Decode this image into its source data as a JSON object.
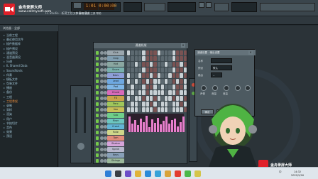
{
  "app": {
    "title_bar": "FL Studio - 新建工程 - 节奏与模式",
    "counter_a": "1:01",
    "counter_b": "0:00:00",
    "menu": [
      "文件",
      "编辑",
      "通道",
      "工具",
      "帮助"
    ]
  },
  "watermark": {
    "name": "金舟录屏大师",
    "url": "www.callmysoft.com"
  },
  "browser": {
    "header": "浏览器 - 全部",
    "items": [
      {
        "label": "当前工程",
        "active": false
      },
      {
        "label": "最近使用文件",
        "active": false
      },
      {
        "label": "插件数据库",
        "active": false
      },
      {
        "label": "插件预设",
        "active": false
      },
      {
        "label": "通道预设",
        "active": false
      },
      {
        "label": "混音器预设",
        "active": false
      },
      {
        "label": "乐谱",
        "active": false
      },
      {
        "label": "IL Shared Data",
        "active": false
      },
      {
        "label": "Soundfonts",
        "active": false
      },
      {
        "label": "伴奏",
        "active": false
      },
      {
        "label": "模板文件",
        "active": false
      },
      {
        "label": "包装文件",
        "active": false
      },
      {
        "label": "播放",
        "active": false
      },
      {
        "label": "备份",
        "active": false
      },
      {
        "label": "工程",
        "active": false
      },
      {
        "label": "工程骨架",
        "active": true
      },
      {
        "label": "录制",
        "active": false
      },
      {
        "label": "采样",
        "active": false
      },
      {
        "label": "渲染",
        "active": false
      },
      {
        "label": "用户",
        "active": false
      },
      {
        "label": "节拍切片",
        "active": false
      },
      {
        "label": "音色",
        "active": false
      },
      {
        "label": "效果",
        "active": false
      },
      {
        "label": "预设",
        "active": false
      }
    ]
  },
  "channel_rack": {
    "title": "通道机架",
    "close": "×",
    "channels": [
      {
        "name": "Kick",
        "color": "#9aa6ad",
        "steps": [
          1,
          0,
          0,
          0,
          1,
          0,
          0,
          0,
          1,
          0,
          0,
          0,
          1,
          0,
          0,
          0
        ]
      },
      {
        "name": "Clap",
        "color": "#7f9db0",
        "steps": [
          0,
          0,
          0,
          0,
          1,
          0,
          0,
          0,
          0,
          0,
          0,
          0,
          1,
          0,
          0,
          0
        ]
      },
      {
        "name": "Hat",
        "color": "#8aa7a1",
        "steps": [
          0,
          0,
          1,
          0,
          0,
          0,
          1,
          0,
          0,
          0,
          1,
          0,
          0,
          0,
          1,
          0
        ]
      },
      {
        "name": "Snare",
        "color": "#79b0ad",
        "steps": [
          0,
          0,
          0,
          0,
          1,
          0,
          0,
          0,
          0,
          0,
          0,
          0,
          1,
          0,
          0,
          1
        ]
      },
      {
        "name": "Bass",
        "color": "#8e9fd8",
        "steps": [
          1,
          0,
          0,
          1,
          0,
          0,
          1,
          0,
          1,
          0,
          0,
          1,
          0,
          0,
          1,
          0
        ]
      },
      {
        "name": "Lead",
        "color": "#6ea8e0",
        "steps": [
          1,
          0,
          1,
          0,
          0,
          1,
          0,
          1,
          1,
          0,
          1,
          0,
          0,
          1,
          0,
          1
        ]
      },
      {
        "name": "Pad",
        "color": "#7fb6e6",
        "steps": [
          0,
          1,
          0,
          0,
          1,
          0,
          0,
          1,
          0,
          1,
          0,
          0,
          1,
          0,
          0,
          1
        ]
      },
      {
        "name": "Chord",
        "color": "#d86ab9",
        "steps": [
          1,
          1,
          0,
          1,
          1,
          0,
          1,
          1,
          1,
          1,
          0,
          1,
          1,
          0,
          1,
          1
        ]
      },
      {
        "name": "FX",
        "color": "#c9a24a",
        "steps": [
          1,
          0,
          1,
          1,
          0,
          1,
          1,
          0,
          1,
          0,
          1,
          1,
          0,
          1,
          1,
          0
        ]
      },
      {
        "name": "Perc",
        "color": "#9fc65a",
        "steps": [
          0,
          1,
          1,
          0,
          1,
          1,
          0,
          1,
          0,
          1,
          1,
          0,
          1,
          1,
          0,
          1
        ]
      },
      {
        "name": "Vox",
        "color": "#c8bf57",
        "steps": [
          1,
          1,
          1,
          0,
          1,
          1,
          1,
          0,
          1,
          1,
          1,
          0,
          1,
          1,
          1,
          0
        ]
      },
      {
        "name": "Sub",
        "color": "#6fcf8a",
        "steps": [
          0,
          0,
          0,
          0,
          0,
          0,
          0,
          0,
          0,
          0,
          0,
          0,
          0,
          0,
          0,
          0
        ]
      },
      {
        "name": "Riser",
        "color": "#6cc6c0",
        "steps": [
          0,
          0,
          0,
          0,
          0,
          0,
          0,
          0,
          0,
          0,
          0,
          0,
          0,
          0,
          0,
          0
        ]
      },
      {
        "name": "Crash",
        "color": "#62b5d6",
        "steps": [
          0,
          0,
          0,
          0,
          0,
          0,
          0,
          0,
          0,
          0,
          0,
          0,
          0,
          0,
          0,
          0
        ]
      },
      {
        "name": "Ride",
        "color": "#cfd68a",
        "steps": [
          0,
          0,
          0,
          0,
          0,
          0,
          0,
          0,
          0,
          0,
          0,
          0,
          0,
          0,
          0,
          0
        ]
      },
      {
        "name": "Tom",
        "color": "#e08a7a",
        "steps": [
          0,
          0,
          0,
          0,
          0,
          0,
          0,
          0,
          0,
          0,
          0,
          0,
          0,
          0,
          0,
          0
        ]
      },
      {
        "name": "Shaker",
        "color": "#d6a4da",
        "steps": [
          0,
          0,
          0,
          0,
          0,
          0,
          0,
          0,
          0,
          0,
          0,
          0,
          0,
          0,
          0,
          0
        ]
      },
      {
        "name": "Synth",
        "color": "#b7b7cc",
        "steps": [
          0,
          0,
          0,
          0,
          0,
          0,
          0,
          0,
          0,
          0,
          0,
          0,
          0,
          0,
          0,
          0
        ]
      },
      {
        "name": "Keys",
        "color": "#88a0b8",
        "steps": [
          0,
          0,
          0,
          0,
          0,
          0,
          0,
          0,
          0,
          0,
          0,
          0,
          0,
          0,
          0,
          0
        ]
      },
      {
        "name": "Strings",
        "color": "#9bb89b",
        "steps": [
          0,
          0,
          0,
          0,
          0,
          0,
          0,
          0,
          0,
          0,
          0,
          0,
          0,
          0,
          0,
          0
        ]
      },
      {
        "name": "Brass",
        "color": "#a5c4cf",
        "steps": [
          0,
          0,
          0,
          0,
          0,
          0,
          0,
          0,
          0,
          0,
          0,
          0,
          0,
          0,
          0,
          0
        ]
      }
    ],
    "velocity": [
      0.9,
      0.5,
      0.7,
      0.4,
      0.8,
      0.6,
      0.95,
      0.3,
      0.75,
      0.55,
      0.85,
      0.45,
      0.65,
      0.9,
      0.5,
      0.7,
      0.8,
      0.35,
      0.6,
      0.9
    ]
  },
  "dialog": {
    "title": "通道设置 - 输出设置",
    "close": "×",
    "label_name": "名称",
    "value_name": "",
    "label_preset": "预设",
    "value_preset": "默认",
    "label_route": "路由",
    "value_route": "--",
    "label_pan": "声像",
    "label_vol": "音量",
    "label_pitch": "音高",
    "btn_ok": "确定",
    "btn_cancel": "取消"
  },
  "taskbar": {
    "time": "14:32",
    "date": "2022/5/16",
    "ime": "中"
  }
}
